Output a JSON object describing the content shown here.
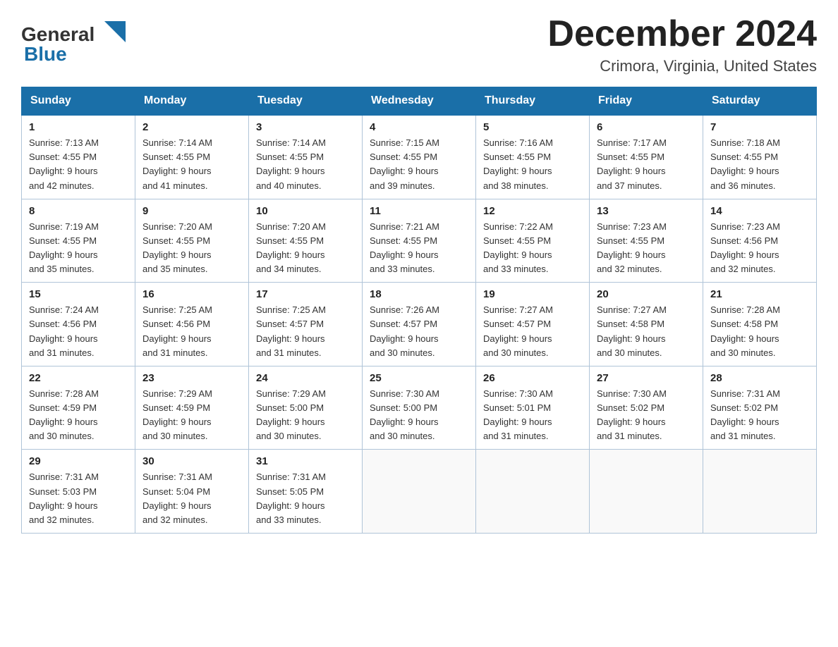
{
  "logo": {
    "general": "General",
    "blue": "Blue",
    "arrow_color": "#1a6fa8"
  },
  "header": {
    "title": "December 2024",
    "subtitle": "Crimora, Virginia, United States"
  },
  "weekdays": [
    "Sunday",
    "Monday",
    "Tuesday",
    "Wednesday",
    "Thursday",
    "Friday",
    "Saturday"
  ],
  "weeks": [
    [
      {
        "day": "1",
        "sunrise": "7:13 AM",
        "sunset": "4:55 PM",
        "daylight": "9 hours and 42 minutes."
      },
      {
        "day": "2",
        "sunrise": "7:14 AM",
        "sunset": "4:55 PM",
        "daylight": "9 hours and 41 minutes."
      },
      {
        "day": "3",
        "sunrise": "7:14 AM",
        "sunset": "4:55 PM",
        "daylight": "9 hours and 40 minutes."
      },
      {
        "day": "4",
        "sunrise": "7:15 AM",
        "sunset": "4:55 PM",
        "daylight": "9 hours and 39 minutes."
      },
      {
        "day": "5",
        "sunrise": "7:16 AM",
        "sunset": "4:55 PM",
        "daylight": "9 hours and 38 minutes."
      },
      {
        "day": "6",
        "sunrise": "7:17 AM",
        "sunset": "4:55 PM",
        "daylight": "9 hours and 37 minutes."
      },
      {
        "day": "7",
        "sunrise": "7:18 AM",
        "sunset": "4:55 PM",
        "daylight": "9 hours and 36 minutes."
      }
    ],
    [
      {
        "day": "8",
        "sunrise": "7:19 AM",
        "sunset": "4:55 PM",
        "daylight": "9 hours and 35 minutes."
      },
      {
        "day": "9",
        "sunrise": "7:20 AM",
        "sunset": "4:55 PM",
        "daylight": "9 hours and 35 minutes."
      },
      {
        "day": "10",
        "sunrise": "7:20 AM",
        "sunset": "4:55 PM",
        "daylight": "9 hours and 34 minutes."
      },
      {
        "day": "11",
        "sunrise": "7:21 AM",
        "sunset": "4:55 PM",
        "daylight": "9 hours and 33 minutes."
      },
      {
        "day": "12",
        "sunrise": "7:22 AM",
        "sunset": "4:55 PM",
        "daylight": "9 hours and 33 minutes."
      },
      {
        "day": "13",
        "sunrise": "7:23 AM",
        "sunset": "4:55 PM",
        "daylight": "9 hours and 32 minutes."
      },
      {
        "day": "14",
        "sunrise": "7:23 AM",
        "sunset": "4:56 PM",
        "daylight": "9 hours and 32 minutes."
      }
    ],
    [
      {
        "day": "15",
        "sunrise": "7:24 AM",
        "sunset": "4:56 PM",
        "daylight": "9 hours and 31 minutes."
      },
      {
        "day": "16",
        "sunrise": "7:25 AM",
        "sunset": "4:56 PM",
        "daylight": "9 hours and 31 minutes."
      },
      {
        "day": "17",
        "sunrise": "7:25 AM",
        "sunset": "4:57 PM",
        "daylight": "9 hours and 31 minutes."
      },
      {
        "day": "18",
        "sunrise": "7:26 AM",
        "sunset": "4:57 PM",
        "daylight": "9 hours and 30 minutes."
      },
      {
        "day": "19",
        "sunrise": "7:27 AM",
        "sunset": "4:57 PM",
        "daylight": "9 hours and 30 minutes."
      },
      {
        "day": "20",
        "sunrise": "7:27 AM",
        "sunset": "4:58 PM",
        "daylight": "9 hours and 30 minutes."
      },
      {
        "day": "21",
        "sunrise": "7:28 AM",
        "sunset": "4:58 PM",
        "daylight": "9 hours and 30 minutes."
      }
    ],
    [
      {
        "day": "22",
        "sunrise": "7:28 AM",
        "sunset": "4:59 PM",
        "daylight": "9 hours and 30 minutes."
      },
      {
        "day": "23",
        "sunrise": "7:29 AM",
        "sunset": "4:59 PM",
        "daylight": "9 hours and 30 minutes."
      },
      {
        "day": "24",
        "sunrise": "7:29 AM",
        "sunset": "5:00 PM",
        "daylight": "9 hours and 30 minutes."
      },
      {
        "day": "25",
        "sunrise": "7:30 AM",
        "sunset": "5:00 PM",
        "daylight": "9 hours and 30 minutes."
      },
      {
        "day": "26",
        "sunrise": "7:30 AM",
        "sunset": "5:01 PM",
        "daylight": "9 hours and 31 minutes."
      },
      {
        "day": "27",
        "sunrise": "7:30 AM",
        "sunset": "5:02 PM",
        "daylight": "9 hours and 31 minutes."
      },
      {
        "day": "28",
        "sunrise": "7:31 AM",
        "sunset": "5:02 PM",
        "daylight": "9 hours and 31 minutes."
      }
    ],
    [
      {
        "day": "29",
        "sunrise": "7:31 AM",
        "sunset": "5:03 PM",
        "daylight": "9 hours and 32 minutes."
      },
      {
        "day": "30",
        "sunrise": "7:31 AM",
        "sunset": "5:04 PM",
        "daylight": "9 hours and 32 minutes."
      },
      {
        "day": "31",
        "sunrise": "7:31 AM",
        "sunset": "5:05 PM",
        "daylight": "9 hours and 33 minutes."
      },
      null,
      null,
      null,
      null
    ]
  ],
  "labels": {
    "sunrise": "Sunrise:",
    "sunset": "Sunset:",
    "daylight": "Daylight:"
  }
}
